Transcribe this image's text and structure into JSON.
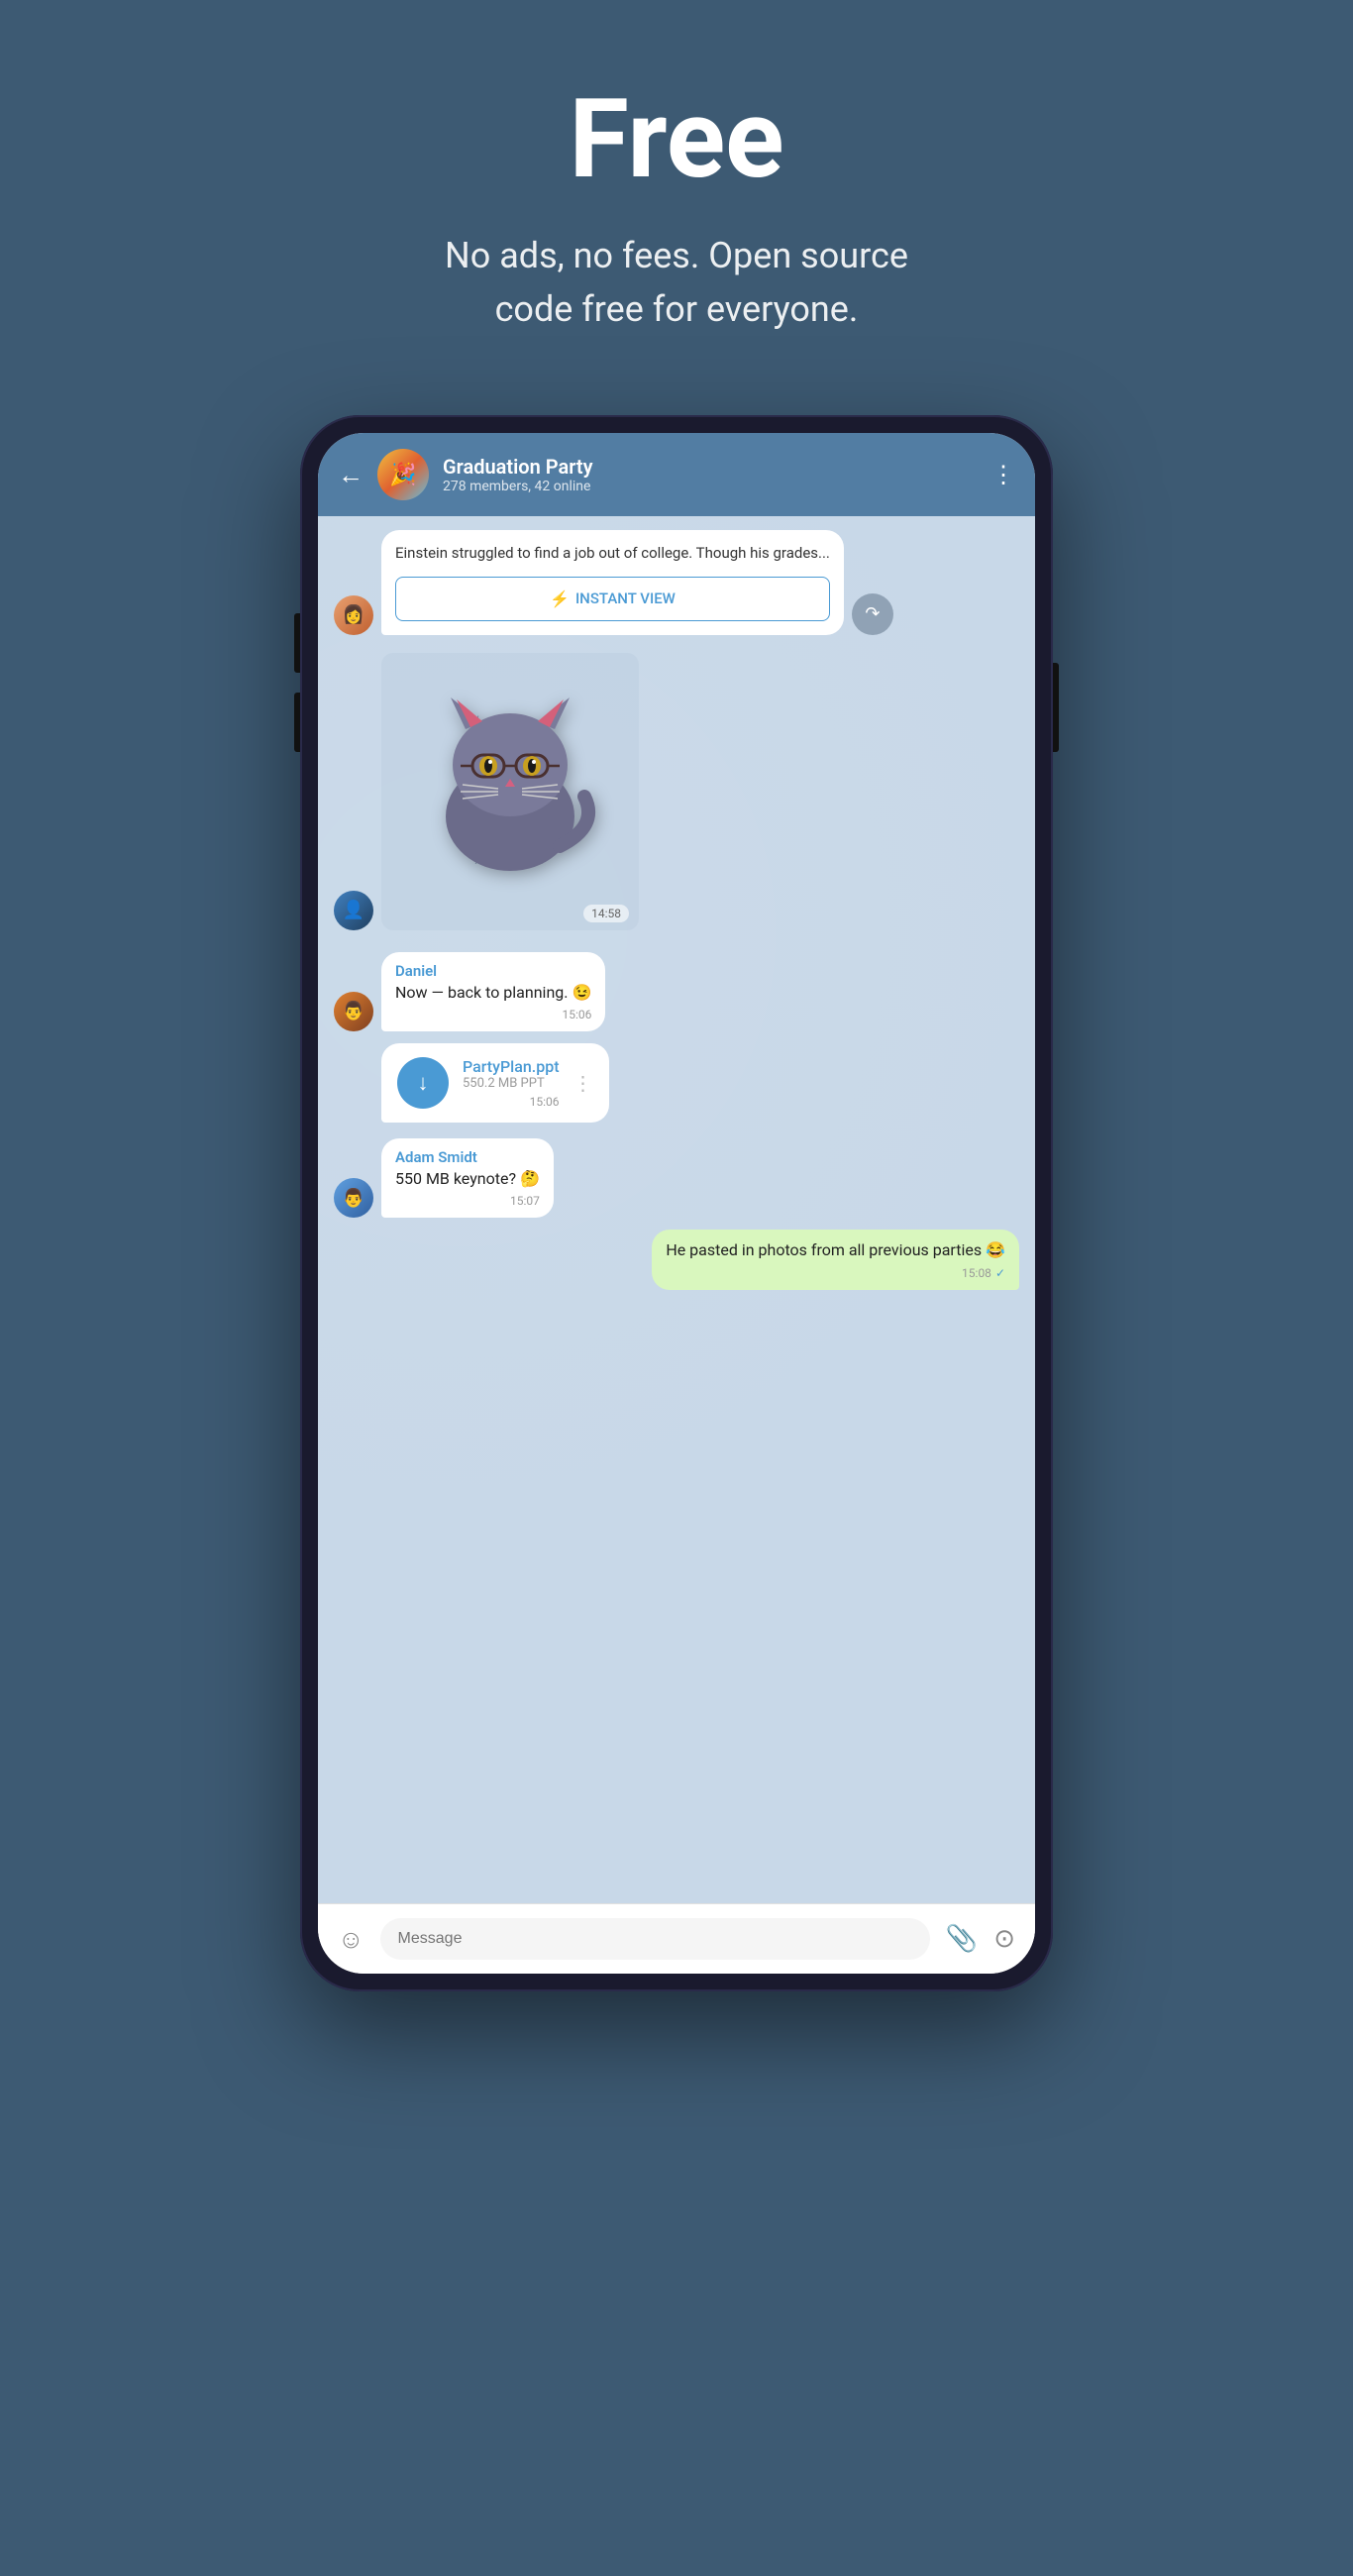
{
  "hero": {
    "title": "Free",
    "subtitle": "No ads, no fees. Open source\ncode free for everyone."
  },
  "phone": {
    "header": {
      "group_name": "Graduation Party",
      "group_meta": "278 members, 42 online",
      "back_label": "←",
      "more_label": "⋮"
    },
    "messages": [
      {
        "id": "link-msg",
        "type": "link",
        "avatar_class": "female",
        "link_text": "Einstein struggled to find a job out of college. Though his grades...",
        "instant_view_label": "INSTANT VIEW",
        "lightning": "⚡"
      },
      {
        "id": "sticker-msg",
        "type": "sticker",
        "avatar_class": "male1",
        "time": "14:58"
      },
      {
        "id": "daniel-msg",
        "type": "text",
        "sender": "Daniel",
        "text": "Now — back to planning. 😉",
        "time": "15:06",
        "avatar_class": "male2"
      },
      {
        "id": "file-msg",
        "type": "file",
        "file_name": "PartyPlan.ppt",
        "file_size": "550.2 MB PPT",
        "time": "15:06",
        "avatar_class": ""
      },
      {
        "id": "adam-msg",
        "type": "text",
        "sender": "Adam Smidt",
        "text": "550 MB keynote? 🤔",
        "time": "15:07",
        "avatar_class": "male3"
      },
      {
        "id": "own-msg",
        "type": "own",
        "text": "He pasted in photos from all previous parties 😂",
        "time": "15:08",
        "check": "✓"
      }
    ],
    "input": {
      "placeholder": "Message",
      "emoji_icon": "☺",
      "attach_icon": "📎",
      "camera_icon": "⊙"
    }
  }
}
